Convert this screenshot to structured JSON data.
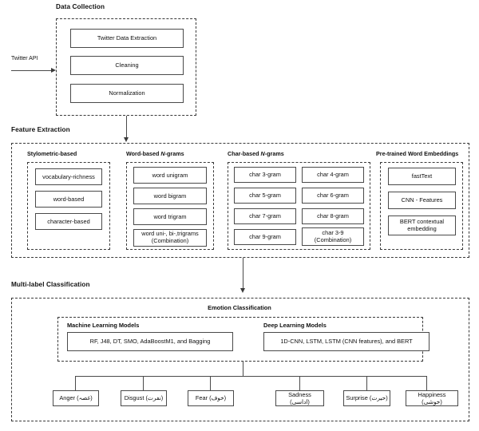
{
  "figure": {
    "sections": {
      "data_collection": "Data Collection",
      "feature_extraction": "Feature Extraction",
      "multilabel_classification": "Multi-label Classification"
    },
    "input": {
      "edge_label": "Twitter API"
    },
    "data_collection_steps": [
      "Twitter Data Extraction",
      "Cleaning",
      "Normalization"
    ],
    "feature_columns": {
      "stylometric": {
        "title_prefix": "Stylometric-based",
        "title_italic": "",
        "title_suffix": "",
        "items": [
          "vocabulary-richness",
          "word-based",
          "character-based"
        ]
      },
      "word_ngrams": {
        "title_prefix": "Word-based ",
        "title_italic": "N",
        "title_suffix": "-grams",
        "items": [
          "word unigram",
          "word bigram",
          "word  trigram",
          "word uni-, bi-,trigrams\n(Combination)"
        ]
      },
      "char_ngrams": {
        "title_prefix": "Char-based ",
        "title_italic": "N",
        "title_suffix": "-grams",
        "left_items": [
          "char 3-gram",
          "char 5-gram",
          "char 7-gram",
          "char 9-gram"
        ],
        "right_items": [
          "char 4-gram",
          "char 6-gram",
          "char 8-gram",
          "char 3-9\n(Combination)"
        ]
      },
      "embeddings": {
        "title_prefix": "Pre-trained Word Embeddings",
        "title_italic": "",
        "title_suffix": "",
        "items": [
          "fastText",
          "CNN - Features",
          "BERT contextual\nembedding"
        ]
      }
    },
    "classification": {
      "title": "Emotion Classification",
      "groups": [
        {
          "title": "Machine Learning Models",
          "models": "RF, J48, DT, SMO, AdaBoostM1, and Bagging"
        },
        {
          "title": "Deep Learning Models",
          "models": "1D-CNN, LSTM, LSTM (CNN features), and BERT"
        }
      ]
    },
    "emotions": [
      {
        "english": "Anger",
        "native": "(غصہ)",
        "label": "Anger (غصہ)"
      },
      {
        "english": "Disgust",
        "native": "(نفرت)",
        "label": "Disgust (نفرت)"
      },
      {
        "english": "Fear",
        "native": "(خوف)",
        "label": "Fear (خوف)"
      },
      {
        "english": "Sadness",
        "native": "(اداسی)",
        "label": "Sadness (اداسی)"
      },
      {
        "english": "Surprise",
        "native": "(حیرت)",
        "label": "Surprise (حیرت)"
      },
      {
        "english": "Happiness",
        "native": "(خوشی)",
        "label": "Happiness (خوشی)"
      }
    ],
    "colors": {
      "stroke": "#4a4a4a",
      "dashed_stroke": "#3a3a3a",
      "text": "#111111",
      "background": "#ffffff"
    }
  }
}
